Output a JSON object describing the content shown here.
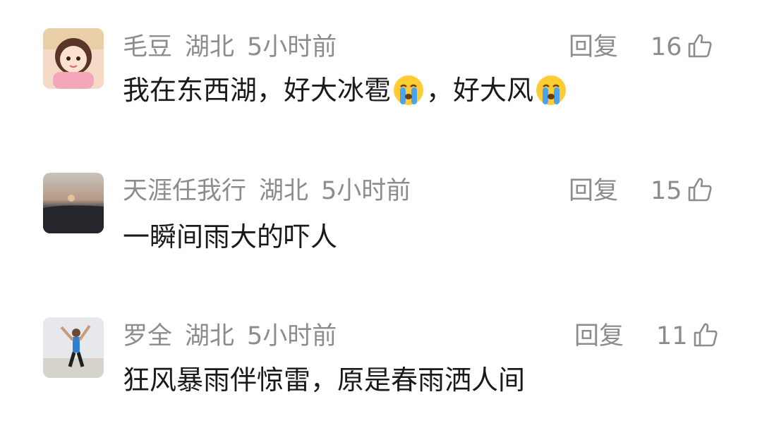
{
  "comments": [
    {
      "username": "毛豆",
      "location": "湖北",
      "time": "5小时前",
      "reply_label": "回复",
      "likes": "16",
      "text_parts": [
        "我在东西湖，好大冰雹",
        "，好大风"
      ],
      "emoji": "crying-face-icon"
    },
    {
      "username": "天涯任我行",
      "location": "湖北",
      "time": "5小时前",
      "reply_label": "回复",
      "likes": "15",
      "text": "一瞬间雨大的吓人"
    },
    {
      "username": "罗全",
      "location": "湖北",
      "time": "5小时前",
      "reply_label": "回复",
      "likes": "11",
      "text": "狂风暴雨伴惊雷，原是春雨洒人间"
    }
  ],
  "colors": {
    "meta_text": "#8c8c8c",
    "body_text": "#1a1a1a",
    "background": "#ffffff"
  }
}
